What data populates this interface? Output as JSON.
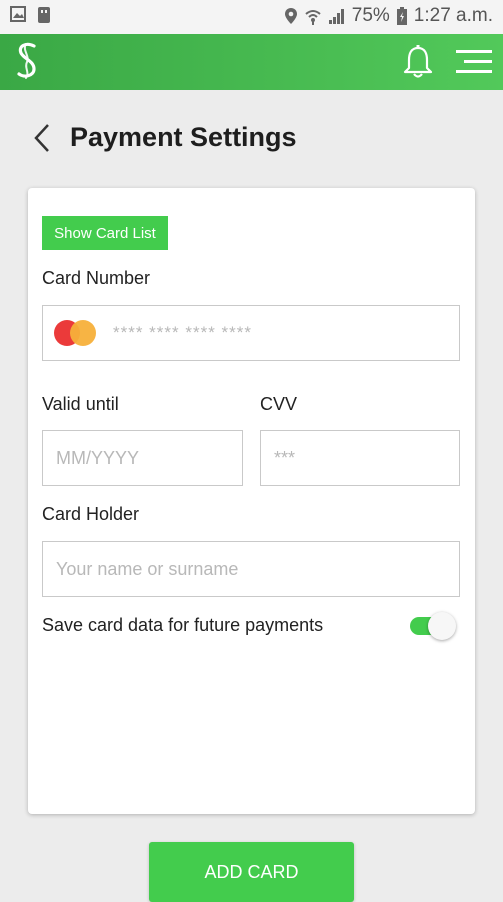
{
  "status_bar": {
    "battery": "75%",
    "time": "1:27 a.m."
  },
  "header": {
    "title": "Payment Settings"
  },
  "card_form": {
    "show_card_list_label": "Show Card List",
    "card_number_label": "Card Number",
    "card_number_placeholder": "**** **** **** ****",
    "valid_until_label": "Valid until",
    "valid_until_placeholder": "MM/YYYY",
    "cvv_label": "CVV",
    "cvv_placeholder": "***",
    "card_holder_label": "Card Holder",
    "card_holder_placeholder": "Your name or surname",
    "save_card_label": "Save card data for future payments",
    "save_card_enabled": true
  },
  "footer": {
    "add_card_label": "ADD CARD"
  },
  "colors": {
    "accent": "#43cc4d",
    "app_bar": "#3aa845"
  },
  "icons": {
    "back": "chevron-left-icon",
    "notifications": "bell-icon",
    "menu": "hamburger-menu-icon",
    "card_brand": "mastercard-icon"
  }
}
